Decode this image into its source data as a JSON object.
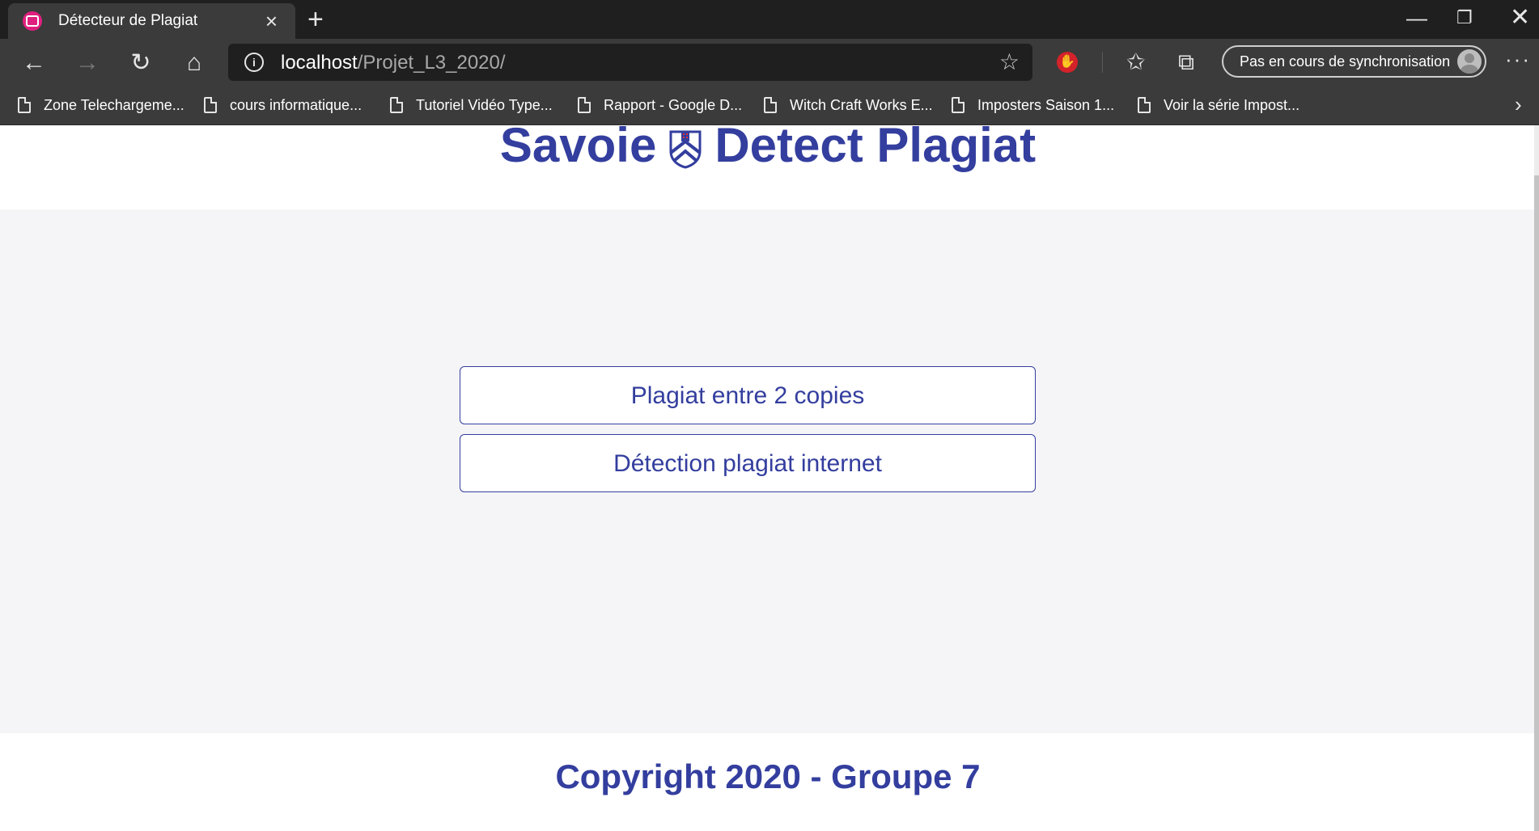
{
  "browser": {
    "tab_title": "Détecteur de Plagiat",
    "url_host": "localhost",
    "url_path": "/Projet_L3_2020/",
    "sync_label": "Pas en cours de synchronisation",
    "bookmarks": [
      "Zone Telechargeme...",
      "cours informatique...",
      "Tutoriel Vidéo Type...",
      "Rapport - Google D...",
      "Witch Craft Works E...",
      "Imposters Saison 1...",
      "Voir la série Impost..."
    ]
  },
  "page": {
    "title_part1": "Savoie",
    "title_part2": "Detect Plagiat",
    "buttons": {
      "copies": "Plagiat entre 2 copies",
      "internet": "Détection plagiat internet"
    },
    "footer": "Copyright 2020 - Groupe 7"
  },
  "colors": {
    "brand": "#333e9e",
    "main_bg": "#f5f5f7",
    "chrome_bg": "#3b3b3b"
  }
}
